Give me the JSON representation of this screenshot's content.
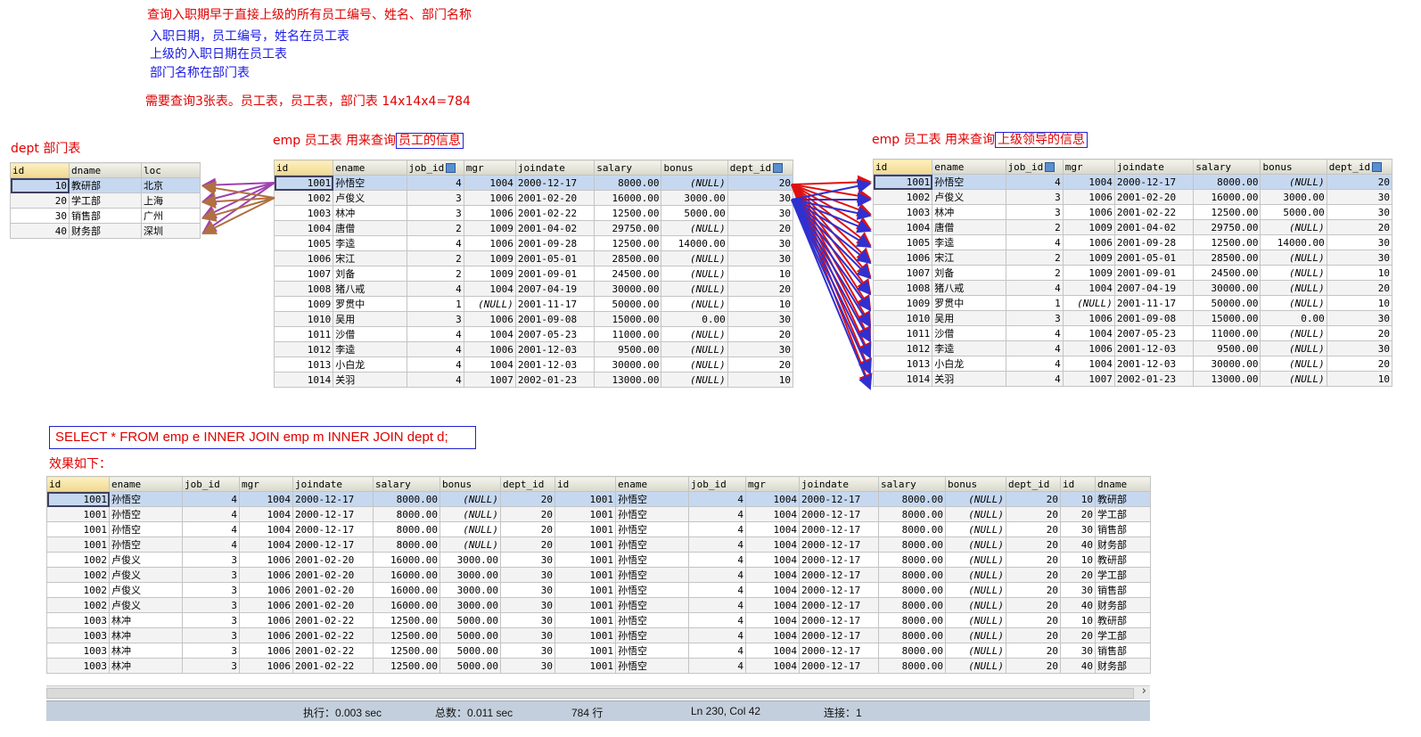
{
  "notes": {
    "line1": "查询入职期早于直接上级的所有员工编号、姓名、部门名称",
    "line2": "入职日期，员工编号，姓名在员工表",
    "line3": "上级的入职日期在员工表",
    "line4": "部门名称在部门表",
    "line5": "需要查询3张表。员工表，员工表，部门表 14x14x4=784",
    "dept_label": "dept 部门表",
    "emp_label_prefix": "emp 员工表   用来查询",
    "emp_label_boxed": "员工的信息",
    "emp2_label_prefix": "emp 员工表  用来查询",
    "emp2_label_boxed": "上级领导的信息",
    "sql": "SELECT * FROM emp e INNER JOIN emp m INNER JOIN dept d;",
    "effect": "效果如下："
  },
  "dept_table": {
    "columns": [
      "id",
      "dname",
      "loc"
    ],
    "rows": [
      [
        "10",
        "教研部",
        "北京"
      ],
      [
        "20",
        "学工部",
        "上海"
      ],
      [
        "30",
        "销售部",
        "广州"
      ],
      [
        "40",
        "财务部",
        "深圳"
      ]
    ]
  },
  "emp_table": {
    "columns": [
      "id",
      "ename",
      "job_id",
      "mgr",
      "joindate",
      "salary",
      "bonus",
      "dept_id"
    ],
    "rows": [
      [
        "1001",
        "孙悟空",
        "4",
        "1004",
        "2000-12-17",
        "8000.00",
        "(NULL)",
        "20"
      ],
      [
        "1002",
        "卢俊义",
        "3",
        "1006",
        "2001-02-20",
        "16000.00",
        "3000.00",
        "30"
      ],
      [
        "1003",
        "林冲",
        "3",
        "1006",
        "2001-02-22",
        "12500.00",
        "5000.00",
        "30"
      ],
      [
        "1004",
        "唐僧",
        "2",
        "1009",
        "2001-04-02",
        "29750.00",
        "(NULL)",
        "20"
      ],
      [
        "1005",
        "李逵",
        "4",
        "1006",
        "2001-09-28",
        "12500.00",
        "14000.00",
        "30"
      ],
      [
        "1006",
        "宋江",
        "2",
        "1009",
        "2001-05-01",
        "28500.00",
        "(NULL)",
        "30"
      ],
      [
        "1007",
        "刘备",
        "2",
        "1009",
        "2001-09-01",
        "24500.00",
        "(NULL)",
        "10"
      ],
      [
        "1008",
        "猪八戒",
        "4",
        "1004",
        "2007-04-19",
        "30000.00",
        "(NULL)",
        "20"
      ],
      [
        "1009",
        "罗贯中",
        "1",
        "(NULL)",
        "2001-11-17",
        "50000.00",
        "(NULL)",
        "10"
      ],
      [
        "1010",
        "吴用",
        "3",
        "1006",
        "2001-09-08",
        "15000.00",
        "0.00",
        "30"
      ],
      [
        "1011",
        "沙僧",
        "4",
        "1004",
        "2007-05-23",
        "11000.00",
        "(NULL)",
        "20"
      ],
      [
        "1012",
        "李逵",
        "4",
        "1006",
        "2001-12-03",
        "9500.00",
        "(NULL)",
        "30"
      ],
      [
        "1013",
        "小白龙",
        "4",
        "1004",
        "2001-12-03",
        "30000.00",
        "(NULL)",
        "20"
      ],
      [
        "1014",
        "关羽",
        "4",
        "1007",
        "2002-01-23",
        "13000.00",
        "(NULL)",
        "10"
      ]
    ]
  },
  "result_table": {
    "columns": [
      "id",
      "ename",
      "job_id",
      "mgr",
      "joindate",
      "salary",
      "bonus",
      "dept_id",
      "id",
      "ename",
      "job_id",
      "mgr",
      "joindate",
      "salary",
      "bonus",
      "dept_id",
      "id",
      "dname"
    ],
    "rows": [
      [
        "1001",
        "孙悟空",
        "4",
        "1004",
        "2000-12-17",
        "8000.00",
        "(NULL)",
        "20",
        "1001",
        "孙悟空",
        "4",
        "1004",
        "2000-12-17",
        "8000.00",
        "(NULL)",
        "20",
        "10",
        "教研部"
      ],
      [
        "1001",
        "孙悟空",
        "4",
        "1004",
        "2000-12-17",
        "8000.00",
        "(NULL)",
        "20",
        "1001",
        "孙悟空",
        "4",
        "1004",
        "2000-12-17",
        "8000.00",
        "(NULL)",
        "20",
        "20",
        "学工部"
      ],
      [
        "1001",
        "孙悟空",
        "4",
        "1004",
        "2000-12-17",
        "8000.00",
        "(NULL)",
        "20",
        "1001",
        "孙悟空",
        "4",
        "1004",
        "2000-12-17",
        "8000.00",
        "(NULL)",
        "20",
        "30",
        "销售部"
      ],
      [
        "1001",
        "孙悟空",
        "4",
        "1004",
        "2000-12-17",
        "8000.00",
        "(NULL)",
        "20",
        "1001",
        "孙悟空",
        "4",
        "1004",
        "2000-12-17",
        "8000.00",
        "(NULL)",
        "20",
        "40",
        "财务部"
      ],
      [
        "1002",
        "卢俊义",
        "3",
        "1006",
        "2001-02-20",
        "16000.00",
        "3000.00",
        "30",
        "1001",
        "孙悟空",
        "4",
        "1004",
        "2000-12-17",
        "8000.00",
        "(NULL)",
        "20",
        "10",
        "教研部"
      ],
      [
        "1002",
        "卢俊义",
        "3",
        "1006",
        "2001-02-20",
        "16000.00",
        "3000.00",
        "30",
        "1001",
        "孙悟空",
        "4",
        "1004",
        "2000-12-17",
        "8000.00",
        "(NULL)",
        "20",
        "20",
        "学工部"
      ],
      [
        "1002",
        "卢俊义",
        "3",
        "1006",
        "2001-02-20",
        "16000.00",
        "3000.00",
        "30",
        "1001",
        "孙悟空",
        "4",
        "1004",
        "2000-12-17",
        "8000.00",
        "(NULL)",
        "20",
        "30",
        "销售部"
      ],
      [
        "1002",
        "卢俊义",
        "3",
        "1006",
        "2001-02-20",
        "16000.00",
        "3000.00",
        "30",
        "1001",
        "孙悟空",
        "4",
        "1004",
        "2000-12-17",
        "8000.00",
        "(NULL)",
        "20",
        "40",
        "财务部"
      ],
      [
        "1003",
        "林冲",
        "3",
        "1006",
        "2001-02-22",
        "12500.00",
        "5000.00",
        "30",
        "1001",
        "孙悟空",
        "4",
        "1004",
        "2000-12-17",
        "8000.00",
        "(NULL)",
        "20",
        "10",
        "教研部"
      ],
      [
        "1003",
        "林冲",
        "3",
        "1006",
        "2001-02-22",
        "12500.00",
        "5000.00",
        "30",
        "1001",
        "孙悟空",
        "4",
        "1004",
        "2000-12-17",
        "8000.00",
        "(NULL)",
        "20",
        "20",
        "学工部"
      ],
      [
        "1003",
        "林冲",
        "3",
        "1006",
        "2001-02-22",
        "12500.00",
        "5000.00",
        "30",
        "1001",
        "孙悟空",
        "4",
        "1004",
        "2000-12-17",
        "8000.00",
        "(NULL)",
        "20",
        "30",
        "销售部"
      ],
      [
        "1003",
        "林冲",
        "3",
        "1006",
        "2001-02-22",
        "12500.00",
        "5000.00",
        "30",
        "1001",
        "孙悟空",
        "4",
        "1004",
        "2000-12-17",
        "8000.00",
        "(NULL)",
        "20",
        "40",
        "财务部"
      ]
    ]
  },
  "status_bar": {
    "exec": "执行：0.003 sec",
    "total": "总数：0.011 sec",
    "rows": "784 行",
    "pos": "Ln 230, Col 42",
    "conn": "连接：1"
  },
  "colors": {
    "annotation_red": "#e00000",
    "annotation_blue": "#1a1ae6",
    "arrow_purple": "#a040b0",
    "arrow_brown": "#b07040",
    "arrow_red": "#e01010",
    "arrow_blue": "#3030d0"
  }
}
